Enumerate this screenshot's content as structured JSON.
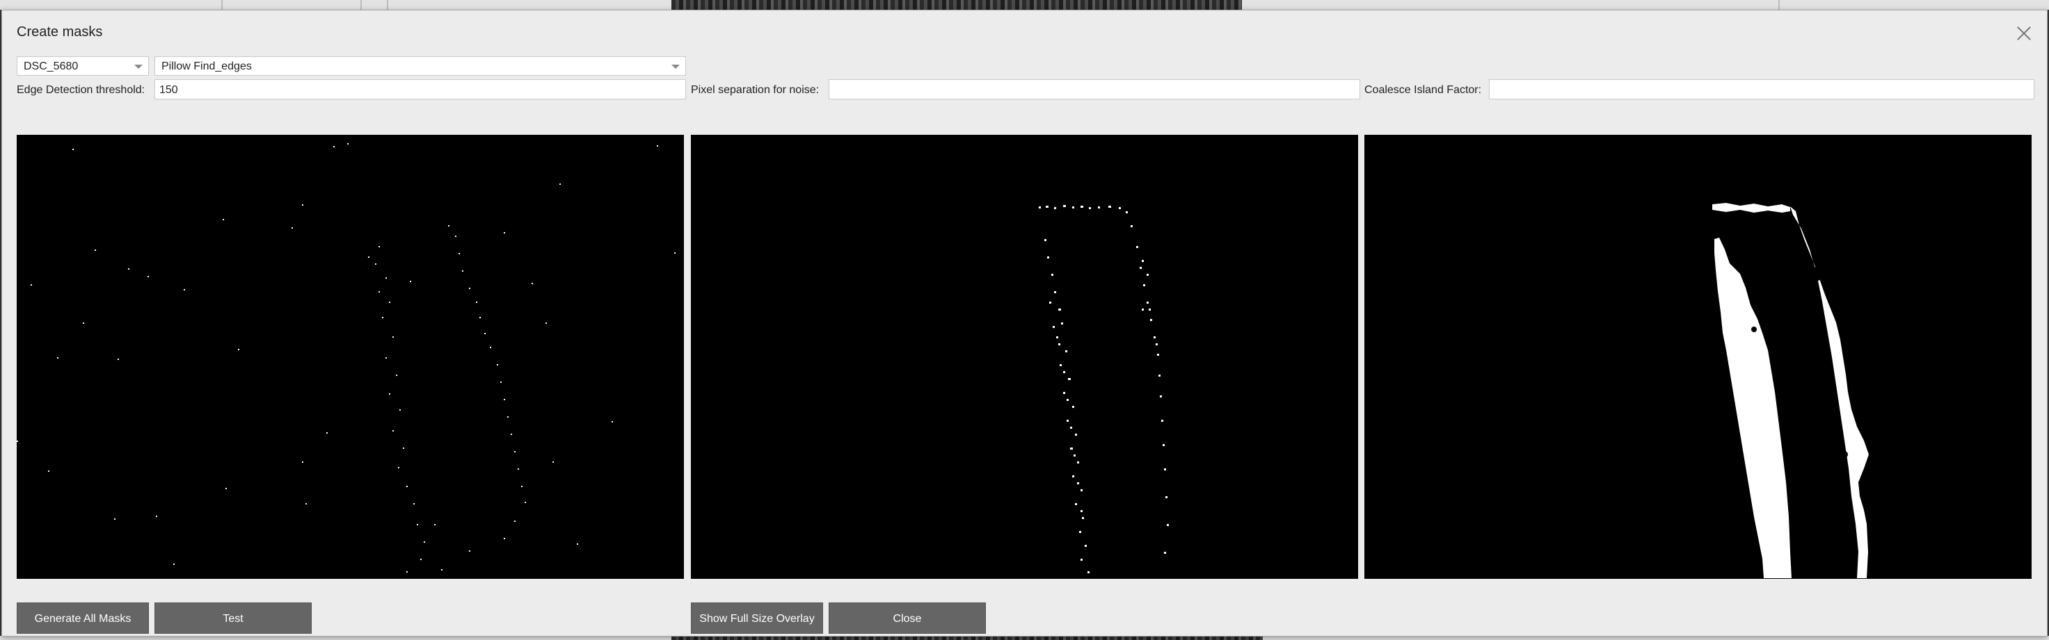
{
  "dialog": {
    "title": "Create masks"
  },
  "controls": {
    "image_select": {
      "value": "DSC_5680"
    },
    "method_select": {
      "value": "Pillow Find_edges"
    },
    "edge_threshold": {
      "label": "Edge Detection threshold:",
      "value": "150"
    },
    "pixel_separation": {
      "label": "Pixel separation for noise:",
      "value": ""
    },
    "coalesce_factor": {
      "label": "Coalesce Island Factor:",
      "value": ""
    }
  },
  "previews": {
    "panels": [
      "edge-detection-preview",
      "noise-filtered-preview",
      "coalesced-mask-preview"
    ]
  },
  "buttons": {
    "generate_all": "Generate All Masks",
    "test": "Test",
    "show_overlay": "Show Full Size Overlay",
    "close": "Close"
  },
  "icons": {
    "close": "close-icon",
    "dropdown": "chevron-down-icon"
  }
}
